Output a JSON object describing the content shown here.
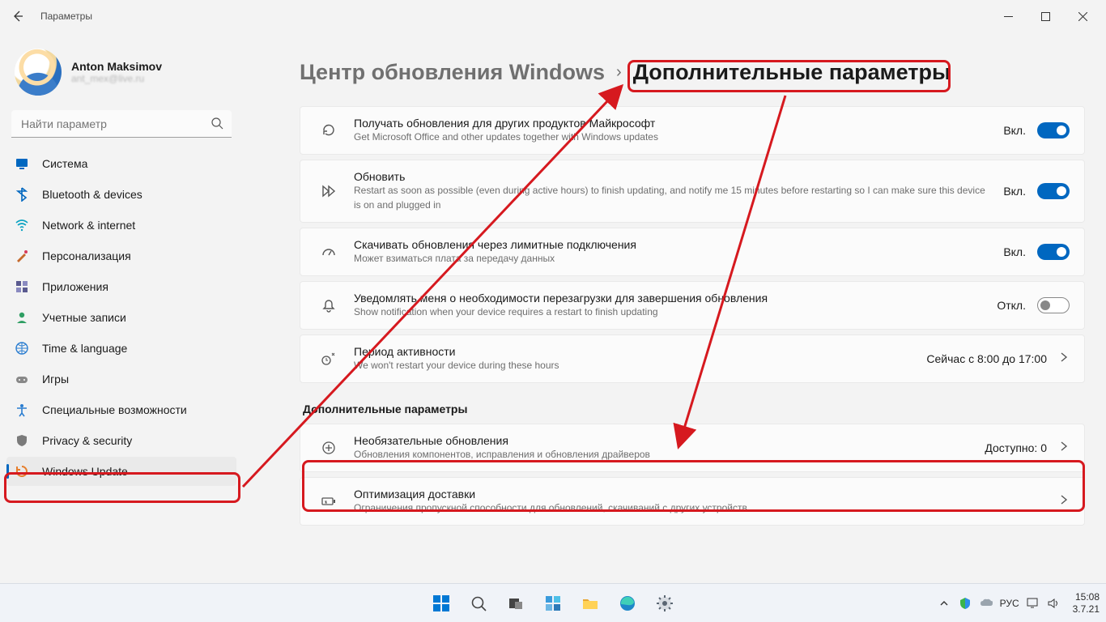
{
  "window": {
    "title": "Параметры"
  },
  "profile": {
    "name": "Anton Maksimov",
    "email": "ant_mex@live.ru"
  },
  "search": {
    "placeholder": "Найти параметр"
  },
  "nav": [
    {
      "label": "Система",
      "icon": "monitor",
      "color": "#0067c0"
    },
    {
      "label": "Bluetooth & devices",
      "icon": "bluetooth",
      "color": "#0067c0"
    },
    {
      "label": "Network & internet",
      "icon": "wifi",
      "color": "#0aa3c2"
    },
    {
      "label": "Персонализация",
      "icon": "brush",
      "color": "#c56a2d"
    },
    {
      "label": "Приложения",
      "icon": "apps",
      "color": "#5a5a8f"
    },
    {
      "label": "Учетные записи",
      "icon": "person",
      "color": "#2f9e63"
    },
    {
      "label": "Time & language",
      "icon": "globe",
      "color": "#2a7dd0"
    },
    {
      "label": "Игры",
      "icon": "gamepad",
      "color": "#888"
    },
    {
      "label": "Специальные возможности",
      "icon": "accessibility",
      "color": "#2a7dd0"
    },
    {
      "label": "Privacy & security",
      "icon": "shield",
      "color": "#7a7a7a"
    },
    {
      "label": "Windows Update",
      "icon": "update",
      "color": "#e67f2e",
      "selected": true
    }
  ],
  "breadcrumb": {
    "a": "Центр обновления Windows",
    "b": "Дополнительные параметры"
  },
  "cards": [
    {
      "icon": "sync",
      "title": "Получать обновления для других продуктов Майкрософт",
      "sub": "Get Microsoft Office and other updates together with Windows updates",
      "state": "Вкл.",
      "on": true
    },
    {
      "icon": "fastforward",
      "title": "Обновить",
      "sub": "Restart as soon as possible (even during active hours) to finish updating, and notify me 15 minutes before restarting so I can make sure this device is on and plugged in",
      "state": "Вкл.",
      "on": true
    },
    {
      "icon": "meter",
      "title": "Скачивать обновления через лимитные подключения",
      "sub": "Может взиматься плата за передачу данных",
      "state": "Вкл.",
      "on": true
    },
    {
      "icon": "bell",
      "title": "Уведомлять меня о необходимости перезагрузки для завершения обновления",
      "sub": "Show notification when your device requires a restart to finish updating",
      "state": "Откл.",
      "on": false
    },
    {
      "icon": "clock",
      "title": "Период активности",
      "sub": "We won't restart your device during these hours",
      "value": "Сейчас с 8:00 до 17:00",
      "nav": true
    }
  ],
  "section2_label": "Дополнительные параметры",
  "cards2": [
    {
      "icon": "plus",
      "title": "Необязательные обновления",
      "sub": "Обновления компонентов, исправления и обновления драйверов",
      "value": "Доступно: 0",
      "nav": true
    },
    {
      "icon": "battery",
      "title": "Оптимизация доставки",
      "sub": "Ограничения пропускной способности для обновлений, скачиваний с других устройств",
      "nav": true
    }
  ],
  "taskbar": {
    "lang": "РУС",
    "time": "15:08",
    "date": "3.7.21"
  }
}
